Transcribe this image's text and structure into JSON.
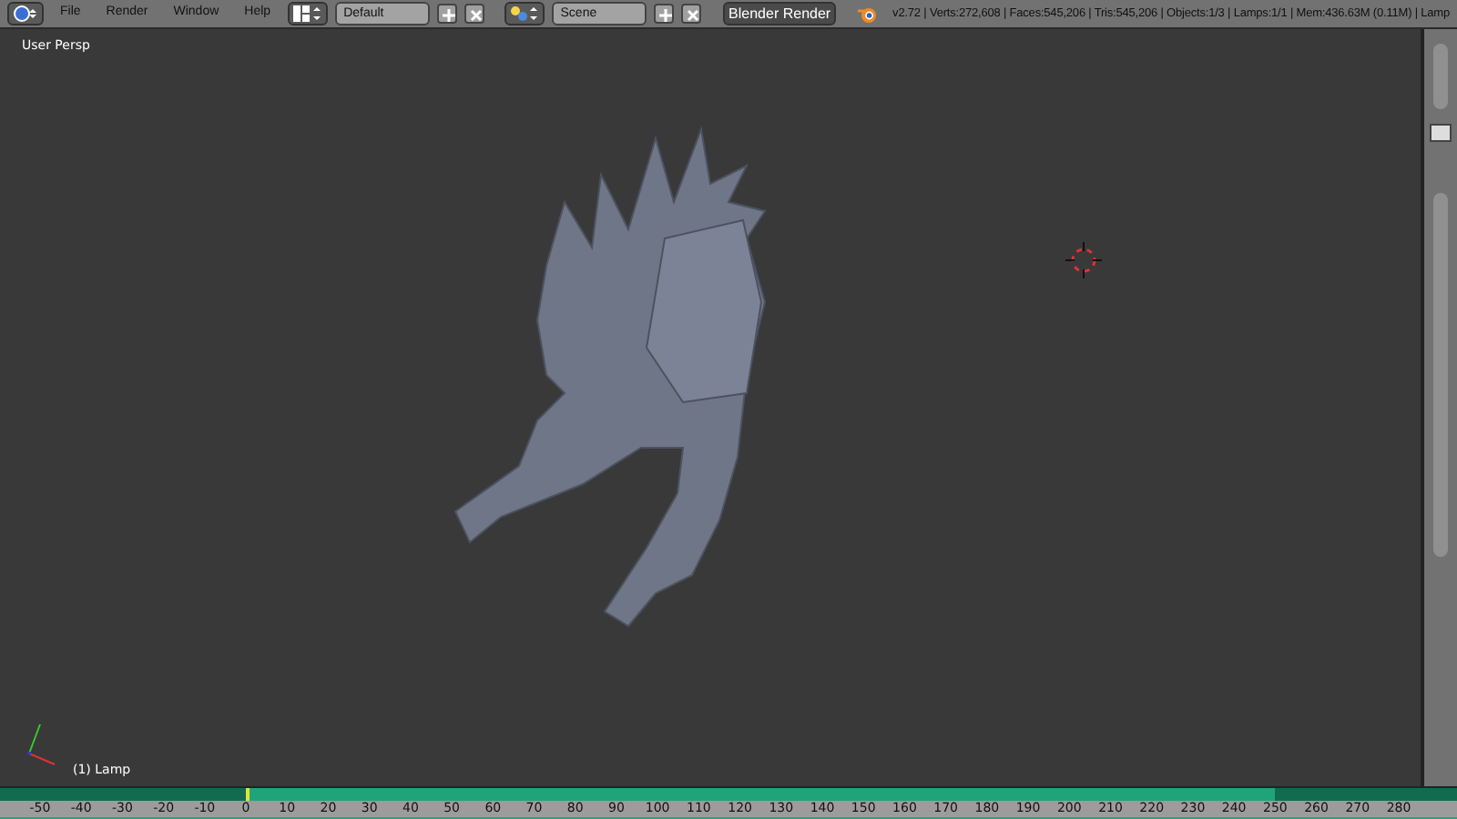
{
  "header": {
    "menus": [
      "File",
      "Render",
      "Window",
      "Help"
    ],
    "layout_field": {
      "value": "Default"
    },
    "scene_field": {
      "value": "Scene"
    },
    "render_engine": {
      "value": "Blender Render"
    },
    "stats": "v2.72 | Verts:272,608 | Faces:545,206 | Tris:545,206 | Objects:1/3 | Lamps:1/1 | Mem:436.63M (0.11M) | Lamp"
  },
  "viewport": {
    "view_label": "User Persp",
    "object_label": "(1) Lamp"
  },
  "timeline": {
    "playhead": {
      "level": 0.152
    },
    "ticks": [
      "-50",
      "-40",
      "-30",
      "-20",
      "-10",
      "0",
      "10",
      "20",
      "30",
      "40",
      "50",
      "60",
      "70",
      "80",
      "90",
      "100",
      "110",
      "120",
      "130",
      "140",
      "150",
      "160",
      "170",
      "180",
      "190",
      "200",
      "210",
      "220",
      "230",
      "240",
      "250",
      "260",
      "270",
      "280"
    ]
  }
}
